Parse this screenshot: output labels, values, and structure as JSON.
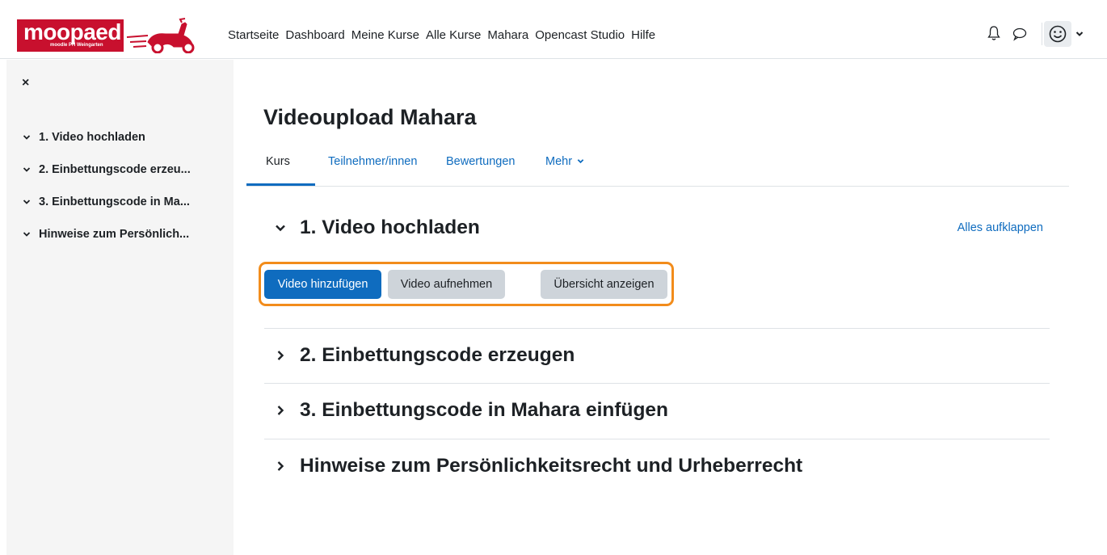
{
  "brand": {
    "logo_text": "moopaed",
    "logo_subtext": "moodle PH Weingarten",
    "color": "#c8102e"
  },
  "nav": {
    "links": [
      "Startseite",
      "Dashboard",
      "Meine Kurse",
      "Alle Kurse",
      "Mahara",
      "Opencast Studio",
      "Hilfe"
    ],
    "icons": [
      "bell-icon",
      "chat-icon",
      "avatar-smiley-icon",
      "chevron-down-icon"
    ]
  },
  "drawer": {
    "close_label": "×",
    "items": [
      "1. Video hochladen",
      "2. Einbettungscode erzeu...",
      "3. Einbettungscode in Ma...",
      "Hinweise zum Persönlich..."
    ]
  },
  "page": {
    "title": "Videoupload Mahara",
    "tabs": [
      "Kurs",
      "Teilnehmer/innen",
      "Bewertungen",
      "Mehr"
    ],
    "active_tab": "Kurs",
    "expand_all": "Alles aufklappen",
    "sections": [
      {
        "title": "1. Video hochladen",
        "expanded": true
      },
      {
        "title": "2. Einbettungscode erzeugen",
        "expanded": false
      },
      {
        "title": "3. Einbettungscode in Mahara einfügen",
        "expanded": false
      },
      {
        "title": "Hinweise zum Persönlichkeitsrecht und Urheberrecht",
        "expanded": false
      }
    ],
    "buttons": {
      "add_video": "Video hinzufügen",
      "record_video": "Video aufnehmen",
      "show_overview": "Übersicht anzeigen"
    }
  },
  "colors": {
    "accent": "#0f6cbf",
    "highlight": "#f28c1b",
    "drawer_bg": "#f5f5f5"
  }
}
